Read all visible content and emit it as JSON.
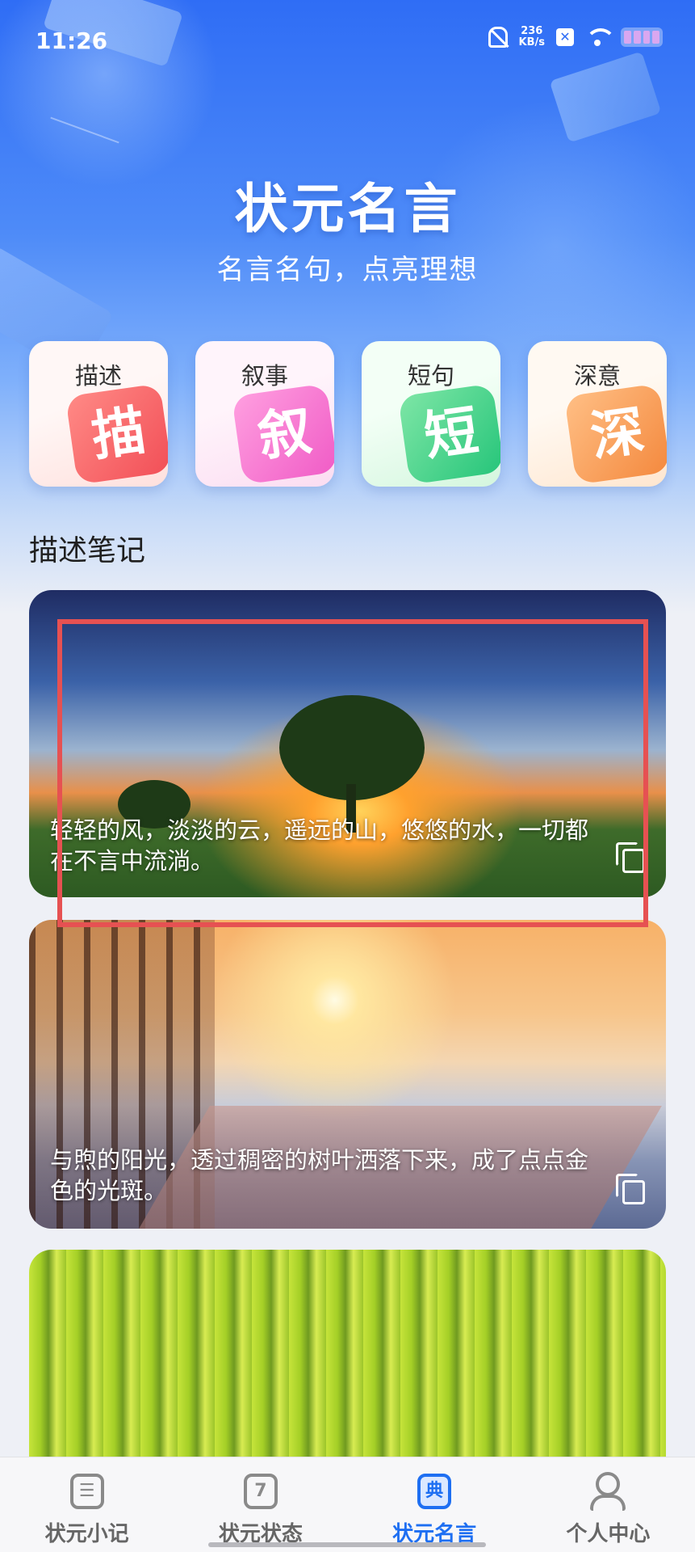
{
  "status_bar": {
    "time": "11:26",
    "network_speed": "236",
    "network_unit": "KB/s",
    "icons": [
      "bell-muted-icon",
      "x-badge-icon",
      "wifi-icon",
      "battery-icon"
    ]
  },
  "header": {
    "title": "状元名言",
    "subtitle": "名言名句，点亮理想"
  },
  "categories": [
    {
      "label": "描述",
      "glyph": "描",
      "color": "#f24f57"
    },
    {
      "label": "叙事",
      "glyph": "叙",
      "color": "#f05cc6"
    },
    {
      "label": "短句",
      "glyph": "短",
      "color": "#26c57a"
    },
    {
      "label": "深意",
      "glyph": "深",
      "color": "#f4893e"
    }
  ],
  "section": {
    "title": "描述笔记"
  },
  "notes": [
    {
      "text": "轻轻的风，淡淡的云，遥远的山，悠悠的水，一切都在不言中流淌。",
      "image": "sunset-tree-meadow"
    },
    {
      "text": "与煦的阳光，透过稠密的树叶洒落下来，成了点点金色的光斑。",
      "image": "misty-sunrise-road"
    },
    {
      "text": "",
      "image": "willow-branches"
    }
  ],
  "bottom_nav": {
    "items": [
      {
        "label": "状元小记",
        "icon": "notes-icon",
        "glyph": "☰"
      },
      {
        "label": "状元状态",
        "icon": "calendar-icon",
        "glyph": "7"
      },
      {
        "label": "状元名言",
        "icon": "dictionary-icon",
        "glyph": "典",
        "active": true
      },
      {
        "label": "个人中心",
        "icon": "user-icon",
        "glyph": ""
      }
    ]
  },
  "colors": {
    "accent": "#1e6ff2",
    "highlight_box": "#e65152"
  }
}
